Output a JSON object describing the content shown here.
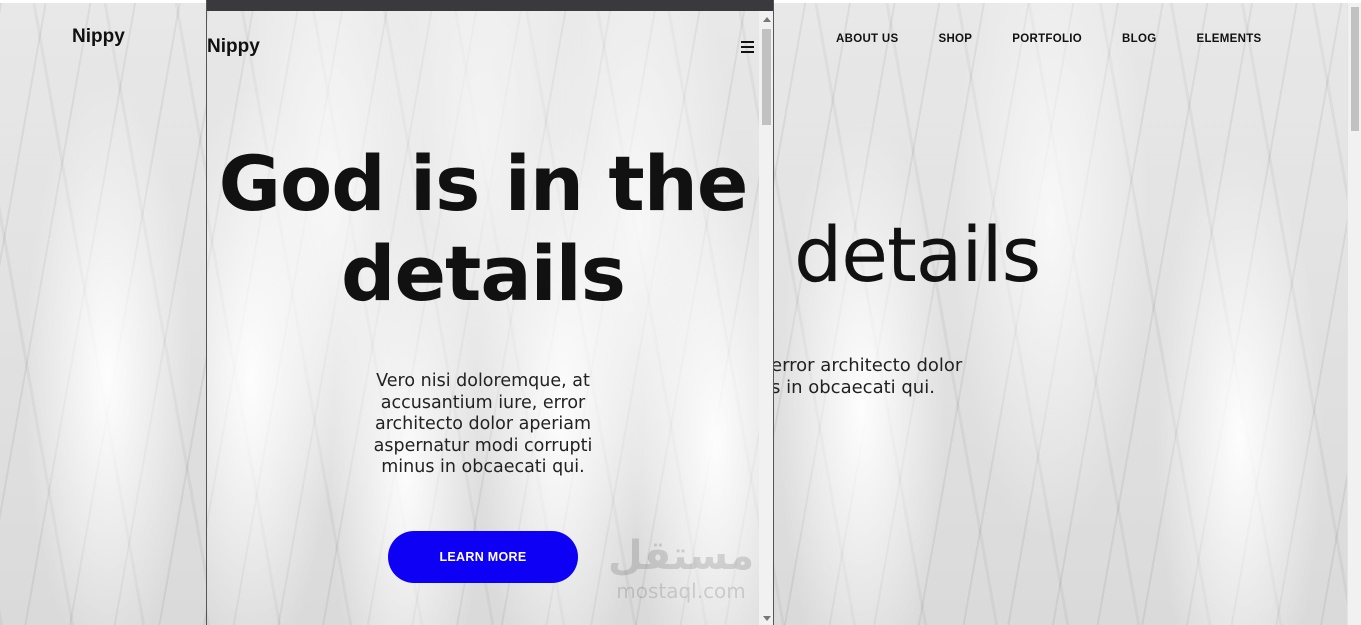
{
  "desktop": {
    "logo": "Nippy",
    "nav": [
      "ABOUT US",
      "SHOP",
      "PORTFOLIO",
      "BLOG",
      "ELEMENTS"
    ],
    "heading_visible": "details",
    "text_line1": "error architecto dolor",
    "text_line2": "s in obcaecati qui."
  },
  "mobile": {
    "logo": "Nippy",
    "menu_icon": "hamburger-icon",
    "heading_line1": "God is in the",
    "heading_line2": "details",
    "body_text": "Vero nisi doloremque, at accusantium iure, error architecto dolor aperiam aspernatur modi corrupti minus in obcaecati qui.",
    "cta_label": "LEARN MORE"
  },
  "colors": {
    "accent": "#0d00f5",
    "text": "#111111",
    "frame_bar": "#3a3a3e"
  },
  "watermark": {
    "main": "مستقل",
    "sub": "mostaql.com"
  }
}
